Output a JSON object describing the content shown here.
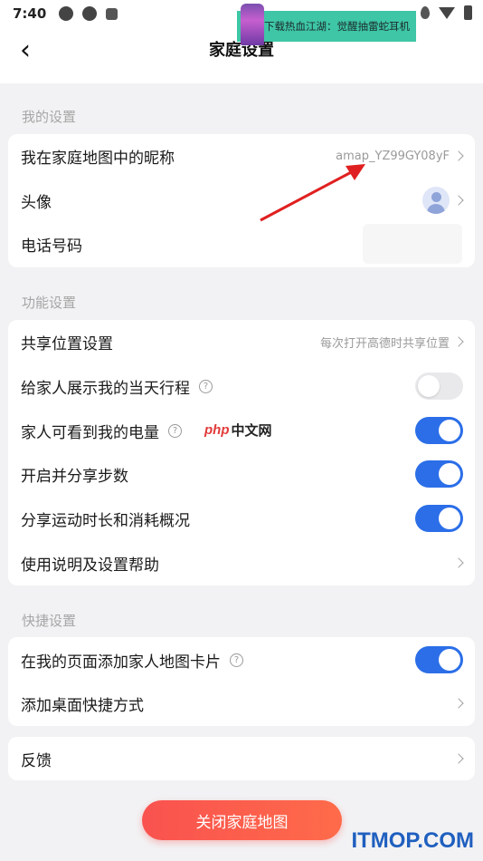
{
  "status_bar": {
    "time": "7:40"
  },
  "banner": {
    "text": "下载热血江湖：觉醒抽雷蛇耳机"
  },
  "header": {
    "title": "家庭设置"
  },
  "my_settings": {
    "section_label": "我的设置",
    "nickname": {
      "label": "我在家庭地图中的昵称",
      "value": "amap_YZ99GY08yF"
    },
    "avatar": {
      "label": "头像",
      "icon": "user-avatar-icon"
    },
    "phone": {
      "label": "电话号码"
    }
  },
  "function_settings": {
    "section_label": "功能设置",
    "share_location": {
      "label": "共享位置设置",
      "value": "每次打开高德时共享位置"
    },
    "show_trip": {
      "label": "给家人展示我的当天行程",
      "enabled": false
    },
    "battery": {
      "label": "家人可看到我的电量",
      "enabled": true
    },
    "steps": {
      "label": "开启并分享步数",
      "enabled": true
    },
    "sport": {
      "label": "分享运动时长和消耗概况",
      "enabled": true
    },
    "help": {
      "label": "使用说明及设置帮助"
    }
  },
  "shortcut_settings": {
    "section_label": "快捷设置",
    "add_card": {
      "label": "在我的页面添加家人地图卡片",
      "enabled": true
    },
    "add_shortcut": {
      "label": "添加桌面快捷方式"
    }
  },
  "feedback": {
    "label": "反馈"
  },
  "close_button": {
    "label": "关闭家庭地图"
  },
  "overlays": {
    "php_logo_1": "php",
    "php_logo_2": "中文网",
    "watermark": "ITMOP.COM",
    "arrow_color": "#e02020"
  },
  "colors": {
    "accent": "#2b6ee8",
    "danger": "#f9524f",
    "background": "#f2f2f4"
  }
}
